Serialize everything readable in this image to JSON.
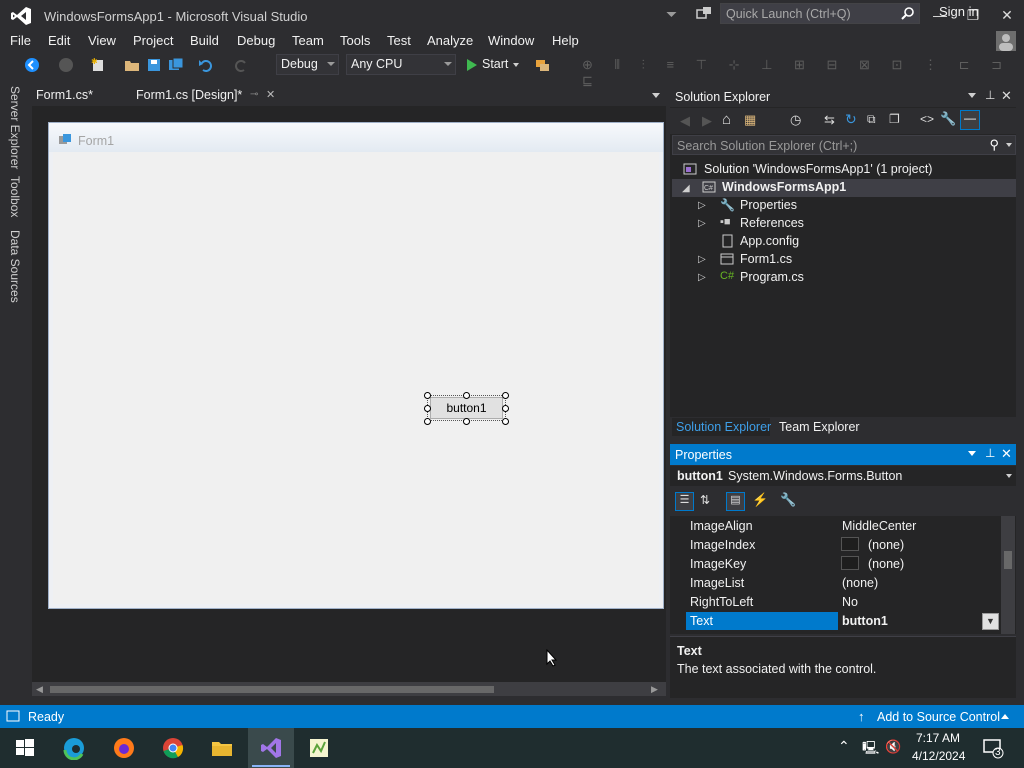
{
  "window": {
    "title": "WindowsFormsApp1 - Microsoft Visual Studio",
    "quick_launch_placeholder": "Quick Launch (Ctrl+Q)",
    "signin": "Sign in"
  },
  "menu": [
    "File",
    "Edit",
    "View",
    "Project",
    "Build",
    "Debug",
    "Team",
    "Tools",
    "Test",
    "Analyze",
    "Window",
    "Help"
  ],
  "toolbar": {
    "config": "Debug",
    "platform": "Any CPU",
    "start_label": "Start"
  },
  "left_strip": [
    "Server Explorer",
    "Toolbox",
    "Data Sources"
  ],
  "doc_tabs": [
    {
      "label": "Form1.cs*"
    },
    {
      "label": "Form1.cs [Design]*"
    }
  ],
  "designer": {
    "form_title": "Form1",
    "button_text": "button1"
  },
  "solution_explorer": {
    "title": "Solution Explorer",
    "search_placeholder": "Search Solution Explorer (Ctrl+;)",
    "items": [
      {
        "label": "Solution 'WindowsFormsApp1' (1 project)"
      },
      {
        "label": "WindowsFormsApp1"
      },
      {
        "label": "Properties"
      },
      {
        "label": "References"
      },
      {
        "label": "App.config"
      },
      {
        "label": "Form1.cs"
      },
      {
        "label": "Program.cs"
      }
    ],
    "tabs": [
      "Solution Explorer",
      "Team Explorer"
    ]
  },
  "properties": {
    "title": "Properties",
    "object_name": "button1",
    "object_type": "System.Windows.Forms.Button",
    "rows": [
      {
        "name": "ImageAlign",
        "value": "MiddleCenter"
      },
      {
        "name": "ImageIndex",
        "value": "(none)"
      },
      {
        "name": "ImageKey",
        "value": "(none)"
      },
      {
        "name": "ImageList",
        "value": "(none)"
      },
      {
        "name": "RightToLeft",
        "value": "No"
      },
      {
        "name": "Text",
        "value": "button1"
      }
    ],
    "desc_title": "Text",
    "desc_text": "The text associated with the control."
  },
  "status": {
    "text": "Ready",
    "source_control": "Add to Source Control"
  },
  "taskbar": {
    "time": "7:17 AM",
    "date": "4/12/2024",
    "notification_count": "3"
  },
  "colors": {
    "accent": "#007acc",
    "bg": "#2d2d30"
  }
}
